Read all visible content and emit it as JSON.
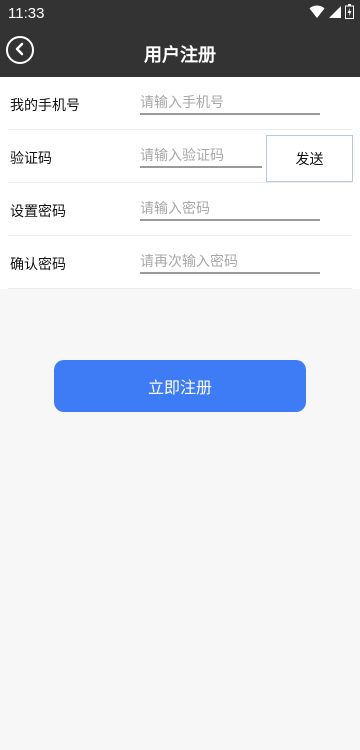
{
  "status_bar": {
    "time": "11:33"
  },
  "header": {
    "title": "用户注册"
  },
  "form": {
    "phone": {
      "label": "我的手机号",
      "placeholder": "请输入手机号"
    },
    "code": {
      "label": "验证码",
      "placeholder": "请输入验证码",
      "send_label": "发送"
    },
    "password": {
      "label": "设置密码",
      "placeholder": "请输入密码"
    },
    "confirm": {
      "label": "确认密码",
      "placeholder": "请再次输入密码"
    }
  },
  "actions": {
    "register_label": "立即注册"
  },
  "colors": {
    "topbar": "#333333",
    "accent": "#3d7cf5",
    "background": "#f7f7f7"
  },
  "icons": {
    "back": "chevron-left-icon",
    "wifi": "wifi-icon",
    "signal": "signal-icon",
    "battery": "battery-icon"
  }
}
